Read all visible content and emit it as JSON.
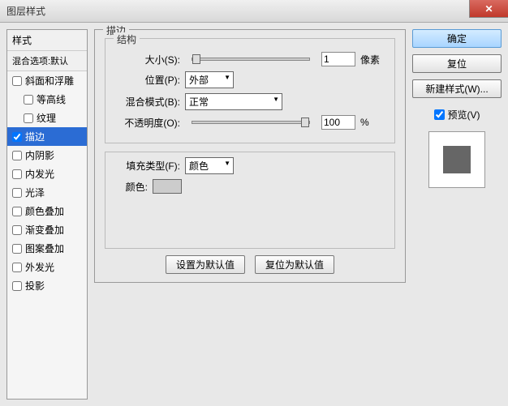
{
  "window": {
    "title": "图层样式"
  },
  "styles_panel": {
    "header": "样式",
    "blend_default": "混合选项:默认",
    "items": [
      {
        "label": "斜面和浮雕",
        "checked": false,
        "indent": false
      },
      {
        "label": "等高线",
        "checked": false,
        "indent": true
      },
      {
        "label": "纹理",
        "checked": false,
        "indent": true
      },
      {
        "label": "描边",
        "checked": true,
        "indent": false,
        "selected": true
      },
      {
        "label": "内阴影",
        "checked": false,
        "indent": false
      },
      {
        "label": "内发光",
        "checked": false,
        "indent": false
      },
      {
        "label": "光泽",
        "checked": false,
        "indent": false
      },
      {
        "label": "颜色叠加",
        "checked": false,
        "indent": false
      },
      {
        "label": "渐变叠加",
        "checked": false,
        "indent": false
      },
      {
        "label": "图案叠加",
        "checked": false,
        "indent": false
      },
      {
        "label": "外发光",
        "checked": false,
        "indent": false
      },
      {
        "label": "投影",
        "checked": false,
        "indent": false
      }
    ]
  },
  "stroke": {
    "group_main": "描边",
    "group_structure": "结构",
    "size_label": "大小(S):",
    "size_value": "1",
    "size_unit": "像素",
    "position_label": "位置(P):",
    "position_value": "外部",
    "blend_label": "混合模式(B):",
    "blend_value": "正常",
    "opacity_label": "不透明度(O):",
    "opacity_value": "100",
    "opacity_unit": "%",
    "fill_type_label": "填充类型(F):",
    "fill_type_value": "颜色",
    "color_label": "颜色:",
    "color_value": "#cccccc",
    "btn_default": "设置为默认值",
    "btn_reset": "复位为默认值"
  },
  "right": {
    "ok": "确定",
    "cancel": "复位",
    "new_style": "新建样式(W)...",
    "preview_label": "预览(V)",
    "preview_checked": true
  }
}
